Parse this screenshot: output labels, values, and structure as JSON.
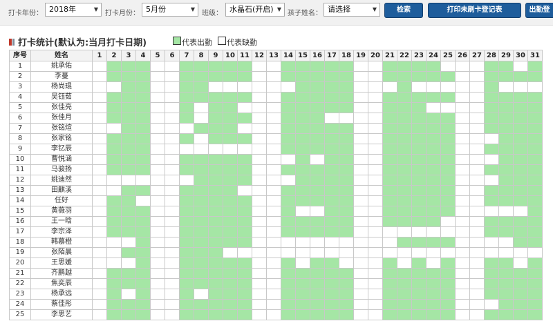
{
  "filters": {
    "year_label": "打卡年份：",
    "year_value": "2018年",
    "month_label": "打卡月份：",
    "month_value": "5月份",
    "class_label": "班级：",
    "class_value": "水晶石(开启)",
    "child_label": "孩子姓名：",
    "child_value": "请选择"
  },
  "buttons": {
    "search": "检索",
    "print": "打印未刷卡登记表",
    "export": "出勤登"
  },
  "heading": "打卡统计(默认为:当月打卡日期)",
  "legend": {
    "present_label": "代表出勤",
    "absent_label": "代表缺勤",
    "present_color": "#a5e6a5",
    "absent_color": "#ffffff"
  },
  "table": {
    "headers": {
      "index": "序号",
      "name": "姓名",
      "days": [
        "1",
        "2",
        "3",
        "4",
        "5",
        "6",
        "7",
        "8",
        "9",
        "10",
        "11",
        "12",
        "13",
        "14",
        "15",
        "16",
        "17",
        "18",
        "19",
        "20",
        "21",
        "22",
        "23",
        "24",
        "25",
        "26",
        "27",
        "28",
        "29",
        "30",
        "31"
      ]
    },
    "rows": [
      {
        "index": "1",
        "name": "姚承佑",
        "days": [
          0,
          1,
          1,
          1,
          0,
          0,
          1,
          1,
          1,
          1,
          1,
          0,
          0,
          1,
          1,
          1,
          1,
          1,
          0,
          0,
          1,
          1,
          1,
          1,
          0,
          0,
          0,
          1,
          1,
          0,
          1
        ]
      },
      {
        "index": "2",
        "name": "李蔓",
        "days": [
          0,
          1,
          1,
          1,
          0,
          0,
          1,
          1,
          1,
          1,
          1,
          0,
          0,
          1,
          1,
          1,
          1,
          1,
          0,
          0,
          1,
          1,
          1,
          1,
          1,
          0,
          0,
          1,
          1,
          1,
          1
        ]
      },
      {
        "index": "3",
        "name": "杨尚琨",
        "days": [
          0,
          0,
          1,
          1,
          0,
          0,
          1,
          1,
          0,
          0,
          0,
          0,
          0,
          0,
          1,
          1,
          1,
          1,
          0,
          0,
          0,
          1,
          0,
          0,
          0,
          0,
          0,
          1,
          0,
          0,
          0
        ]
      },
      {
        "index": "4",
        "name": "吴钰茹",
        "days": [
          0,
          1,
          1,
          1,
          0,
          0,
          1,
          1,
          1,
          1,
          1,
          0,
          0,
          1,
          1,
          1,
          1,
          1,
          0,
          0,
          1,
          1,
          1,
          1,
          1,
          0,
          0,
          1,
          1,
          1,
          1
        ]
      },
      {
        "index": "5",
        "name": "张佳亮",
        "days": [
          0,
          1,
          1,
          1,
          0,
          0,
          1,
          0,
          1,
          1,
          0,
          0,
          0,
          1,
          1,
          1,
          1,
          1,
          0,
          0,
          1,
          1,
          1,
          0,
          0,
          0,
          0,
          1,
          1,
          1,
          1
        ]
      },
      {
        "index": "6",
        "name": "张佳月",
        "days": [
          0,
          1,
          1,
          1,
          0,
          0,
          1,
          0,
          1,
          1,
          1,
          0,
          0,
          1,
          1,
          1,
          0,
          0,
          0,
          0,
          1,
          1,
          1,
          1,
          1,
          0,
          0,
          1,
          1,
          1,
          1
        ]
      },
      {
        "index": "7",
        "name": "张铭煊",
        "days": [
          0,
          0,
          1,
          1,
          0,
          0,
          0,
          1,
          1,
          1,
          0,
          0,
          0,
          1,
          1,
          1,
          1,
          1,
          0,
          0,
          1,
          1,
          1,
          1,
          1,
          0,
          0,
          1,
          1,
          1,
          1
        ]
      },
      {
        "index": "8",
        "name": "张家铭",
        "days": [
          0,
          1,
          1,
          1,
          0,
          0,
          1,
          0,
          1,
          1,
          1,
          0,
          0,
          1,
          1,
          1,
          1,
          1,
          0,
          0,
          1,
          1,
          1,
          1,
          1,
          0,
          0,
          0,
          1,
          1,
          1
        ]
      },
      {
        "index": "9",
        "name": "李钇辰",
        "days": [
          0,
          1,
          1,
          1,
          0,
          0,
          0,
          0,
          0,
          0,
          0,
          0,
          0,
          1,
          1,
          1,
          1,
          1,
          0,
          0,
          1,
          1,
          1,
          1,
          1,
          0,
          0,
          1,
          1,
          1,
          1
        ]
      },
      {
        "index": "10",
        "name": "曹悦涵",
        "days": [
          0,
          1,
          1,
          1,
          0,
          0,
          1,
          1,
          1,
          1,
          1,
          0,
          0,
          0,
          1,
          0,
          1,
          1,
          0,
          0,
          1,
          1,
          1,
          1,
          1,
          0,
          0,
          0,
          1,
          1,
          1
        ]
      },
      {
        "index": "11",
        "name": "马骏扬",
        "days": [
          0,
          1,
          1,
          1,
          0,
          0,
          1,
          1,
          1,
          1,
          1,
          0,
          0,
          1,
          1,
          1,
          1,
          1,
          0,
          0,
          1,
          1,
          1,
          1,
          1,
          0,
          0,
          1,
          1,
          1,
          1
        ]
      },
      {
        "index": "12",
        "name": "姚迪然",
        "days": [
          0,
          0,
          0,
          0,
          0,
          0,
          0,
          1,
          1,
          1,
          1,
          0,
          0,
          0,
          1,
          1,
          1,
          1,
          0,
          0,
          1,
          1,
          1,
          1,
          1,
          0,
          0,
          0,
          1,
          1,
          1
        ]
      },
      {
        "index": "13",
        "name": "田麒溪",
        "days": [
          0,
          0,
          1,
          1,
          0,
          0,
          1,
          1,
          1,
          1,
          0,
          0,
          0,
          1,
          1,
          1,
          1,
          1,
          0,
          0,
          1,
          1,
          1,
          1,
          1,
          0,
          0,
          1,
          1,
          1,
          1
        ]
      },
      {
        "index": "14",
        "name": "任好",
        "days": [
          0,
          1,
          1,
          0,
          0,
          0,
          1,
          1,
          1,
          1,
          1,
          0,
          0,
          1,
          1,
          1,
          1,
          1,
          0,
          0,
          1,
          1,
          1,
          1,
          1,
          0,
          0,
          1,
          1,
          1,
          1
        ]
      },
      {
        "index": "15",
        "name": "黄薇羽",
        "days": [
          0,
          1,
          1,
          1,
          0,
          0,
          1,
          1,
          1,
          1,
          1,
          0,
          0,
          1,
          0,
          0,
          1,
          1,
          0,
          0,
          1,
          1,
          1,
          1,
          1,
          0,
          0,
          0,
          0,
          0,
          1
        ]
      },
      {
        "index": "16",
        "name": "王一晗",
        "days": [
          0,
          1,
          1,
          1,
          0,
          0,
          1,
          1,
          1,
          1,
          1,
          0,
          0,
          1,
          1,
          1,
          1,
          1,
          0,
          0,
          1,
          1,
          1,
          1,
          0,
          0,
          0,
          1,
          1,
          1,
          1
        ]
      },
      {
        "index": "17",
        "name": "李宗泽",
        "days": [
          0,
          1,
          1,
          1,
          0,
          0,
          1,
          1,
          1,
          1,
          1,
          0,
          0,
          1,
          1,
          1,
          1,
          1,
          0,
          0,
          0,
          0,
          0,
          0,
          0,
          0,
          0,
          1,
          1,
          1,
          1
        ]
      },
      {
        "index": "18",
        "name": "韩慕橙",
        "days": [
          0,
          0,
          0,
          1,
          0,
          0,
          1,
          1,
          1,
          1,
          1,
          0,
          0,
          0,
          0,
          0,
          0,
          0,
          0,
          0,
          0,
          1,
          1,
          1,
          1,
          0,
          0,
          0,
          0,
          1,
          1
        ]
      },
      {
        "index": "19",
        "name": "张陌晨",
        "days": [
          0,
          0,
          1,
          1,
          0,
          0,
          1,
          1,
          1,
          0,
          0,
          0,
          0,
          0,
          0,
          0,
          0,
          0,
          0,
          0,
          0,
          0,
          0,
          0,
          0,
          0,
          0,
          0,
          0,
          0,
          0
        ]
      },
      {
        "index": "20",
        "name": "王思媛",
        "days": [
          0,
          0,
          0,
          1,
          0,
          0,
          1,
          1,
          1,
          1,
          1,
          0,
          0,
          1,
          0,
          1,
          1,
          0,
          0,
          0,
          1,
          0,
          1,
          0,
          1,
          0,
          0,
          1,
          1,
          0,
          1
        ]
      },
      {
        "index": "21",
        "name": "齐鹏越",
        "days": [
          0,
          1,
          1,
          1,
          0,
          0,
          1,
          1,
          1,
          1,
          1,
          0,
          0,
          1,
          1,
          1,
          1,
          1,
          0,
          0,
          1,
          1,
          1,
          1,
          1,
          0,
          0,
          1,
          1,
          1,
          1
        ]
      },
      {
        "index": "22",
        "name": "焦奕辰",
        "days": [
          0,
          1,
          1,
          1,
          0,
          0,
          1,
          1,
          1,
          1,
          1,
          0,
          0,
          1,
          1,
          1,
          1,
          1,
          0,
          0,
          1,
          1,
          1,
          1,
          1,
          0,
          0,
          1,
          1,
          1,
          1
        ]
      },
      {
        "index": "23",
        "name": "杨承远",
        "days": [
          0,
          1,
          0,
          1,
          0,
          0,
          1,
          0,
          1,
          1,
          1,
          0,
          0,
          1,
          1,
          1,
          1,
          1,
          0,
          0,
          1,
          1,
          1,
          1,
          1,
          0,
          0,
          1,
          1,
          1,
          1
        ]
      },
      {
        "index": "24",
        "name": "蔡佳彤",
        "days": [
          0,
          1,
          1,
          1,
          0,
          0,
          1,
          1,
          1,
          1,
          1,
          0,
          0,
          1,
          1,
          1,
          1,
          1,
          0,
          0,
          1,
          1,
          1,
          1,
          1,
          0,
          0,
          0,
          1,
          1,
          1
        ]
      },
      {
        "index": "25",
        "name": "李思艺",
        "days": [
          0,
          1,
          1,
          1,
          0,
          0,
          1,
          1,
          1,
          1,
          1,
          0,
          0,
          1,
          1,
          1,
          1,
          1,
          0,
          0,
          1,
          1,
          1,
          1,
          1,
          0,
          0,
          1,
          1,
          1,
          1
        ]
      }
    ]
  }
}
